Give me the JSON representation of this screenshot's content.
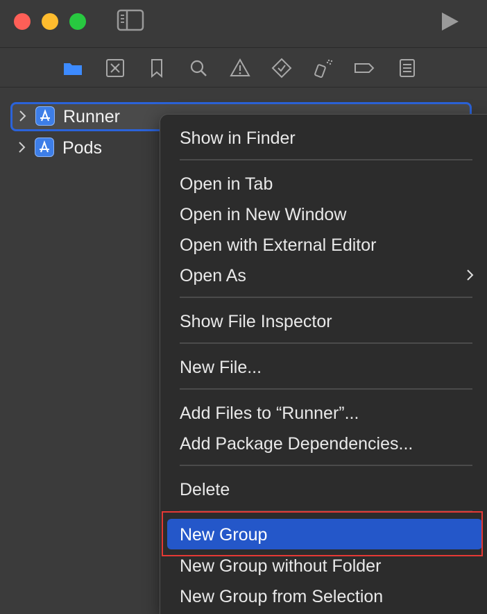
{
  "navigator": {
    "items": [
      {
        "name": "Runner",
        "icon": "app-project-icon",
        "selected": true
      },
      {
        "name": "Pods",
        "icon": "app-project-icon",
        "selected": false
      }
    ]
  },
  "context_menu": {
    "items": [
      {
        "label": "Show in Finder"
      },
      {
        "label": "Open in Tab"
      },
      {
        "label": "Open in New Window"
      },
      {
        "label": "Open with External Editor"
      },
      {
        "label": "Open As",
        "has_submenu": true
      },
      {
        "label": "Show File Inspector"
      },
      {
        "label": "New File..."
      },
      {
        "label": "Add Files to “Runner”..."
      },
      {
        "label": "Add Package Dependencies..."
      },
      {
        "label": "Delete"
      },
      {
        "label": "New Group",
        "highlighted": true
      },
      {
        "label": "New Group without Folder"
      },
      {
        "label": "New Group from Selection"
      }
    ]
  },
  "colors": {
    "highlight": "#2457c9",
    "selection_border": "#2b63d9",
    "annotation_box": "#e53935",
    "active_nav_icon": "#3d8bff"
  }
}
